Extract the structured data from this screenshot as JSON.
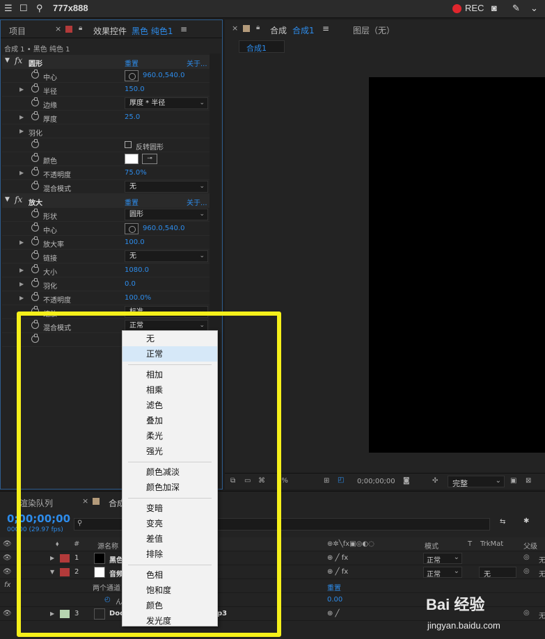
{
  "window": {
    "title": "777x888",
    "rec_label": "REC"
  },
  "left_panel": {
    "tab_project": "项目",
    "tab_effects_prefix": "效果控件",
    "tab_effects_layer": "黑色 纯色1",
    "breadcrumb": "合成 1 • 黑色 纯色 1",
    "effects": [
      {
        "name": "圆形",
        "reset": "重置",
        "about": "关于...",
        "props": [
          {
            "label": "中心",
            "value": "960.0,540.0",
            "kind": "point"
          },
          {
            "label": "半径",
            "value": "150.0",
            "kind": "num",
            "twirl": true
          },
          {
            "label": "边缘",
            "value": "厚度 * 半径",
            "kind": "dropdown"
          },
          {
            "label": "厚度",
            "value": "25.0",
            "kind": "num",
            "twirl": true
          },
          {
            "label": "羽化",
            "value": "",
            "kind": "group",
            "twirl": true
          },
          {
            "label": "",
            "value": "反转圆形",
            "kind": "checkbox"
          },
          {
            "label": "颜色",
            "value": "",
            "kind": "color"
          },
          {
            "label": "不透明度",
            "value": "75.0%",
            "kind": "num",
            "twirl": true
          },
          {
            "label": "混合模式",
            "value": "无",
            "kind": "dropdown"
          }
        ]
      },
      {
        "name": "放大",
        "reset": "重置",
        "about": "关于...",
        "props": [
          {
            "label": "形状",
            "value": "圆形",
            "kind": "dropdown"
          },
          {
            "label": "中心",
            "value": "960.0,540.0",
            "kind": "point"
          },
          {
            "label": "放大率",
            "value": "100.0",
            "kind": "num",
            "twirl": true
          },
          {
            "label": "链接",
            "value": "无",
            "kind": "dropdown"
          },
          {
            "label": "大小",
            "value": "1080.0",
            "kind": "num",
            "twirl": true
          },
          {
            "label": "羽化",
            "value": "0.0",
            "kind": "num",
            "twirl": true
          },
          {
            "label": "不透明度",
            "value": "100.0%",
            "kind": "num",
            "twirl": true
          },
          {
            "label": "缩放",
            "value": "标准",
            "kind": "dropdown"
          },
          {
            "label": "混合模式",
            "value": "正常",
            "kind": "dropdown"
          },
          {
            "label": "",
            "value": "",
            "kind": "empty"
          }
        ]
      }
    ]
  },
  "comp_panel": {
    "tab_prefix": "合成",
    "tab_name": "合成1",
    "layer_tab": "图层（无）",
    "subtab": "合成1",
    "zoom": "0%",
    "timecode": "0;00;00;00",
    "resolution": "完整"
  },
  "timeline": {
    "tab_render": "渲染队列",
    "tab_comp": "合成1",
    "timecode": "0;00;00;00",
    "fps": "00000 (29.97 fps)",
    "search_placeholder": "",
    "col_hash": "#",
    "col_source": "源名称",
    "col_mode": "模式",
    "col_t": "T",
    "col_trkmat": "TrkMat",
    "col_parent": "父级",
    "layers": [
      {
        "num": "1",
        "name": "黑色",
        "label_color": "#b23a3a",
        "thumb": "#000000",
        "mode": "正常",
        "trkmat": "",
        "parent": "无"
      },
      {
        "num": "2",
        "name": "音频",
        "label_color": "#b23a3a",
        "thumb": "#ffffff",
        "mode": "正常",
        "trkmat": "无",
        "parent": "无"
      },
      {
        "num": "3",
        "name": "Doc",
        "label_color": "#b7d5b0",
        "thumb": "",
        "mode": "",
        "trkmat": "",
        "parent": "无",
        "tail": "p3"
      }
    ],
    "sub_group": "两个通道",
    "sub_reset": "重置",
    "sub_prop": "ん",
    "sub_value": "0.00"
  },
  "menu": {
    "items": [
      {
        "label": "无",
        "group": 0
      },
      {
        "label": "正常",
        "group": 0,
        "selected": true
      },
      {
        "label": "相加",
        "group": 1
      },
      {
        "label": "相乘",
        "group": 1
      },
      {
        "label": "滤色",
        "group": 1
      },
      {
        "label": "叠加",
        "group": 1
      },
      {
        "label": "柔光",
        "group": 1
      },
      {
        "label": "强光",
        "group": 1
      },
      {
        "label": "颜色减淡",
        "group": 2
      },
      {
        "label": "颜色加深",
        "group": 2
      },
      {
        "label": "变暗",
        "group": 3
      },
      {
        "label": "变亮",
        "group": 3
      },
      {
        "label": "差值",
        "group": 3
      },
      {
        "label": "排除",
        "group": 3
      },
      {
        "label": "色相",
        "group": 4
      },
      {
        "label": "饱和度",
        "group": 4
      },
      {
        "label": "颜色",
        "group": 4
      },
      {
        "label": "发光度",
        "group": 4
      }
    ]
  },
  "watermark": {
    "brand": "Bai 经验",
    "url": "jingyan.baidu.com"
  },
  "colors": {
    "accent_blue": "#2d8ceb",
    "highlight_yellow": "#f5f01a",
    "rec_red": "#e0262d"
  }
}
